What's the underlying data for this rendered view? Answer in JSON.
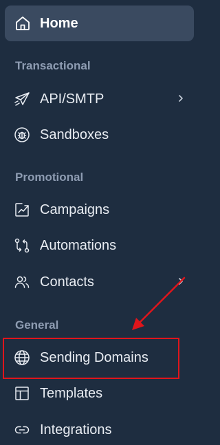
{
  "nav": {
    "home": {
      "label": "Home",
      "icon": "home-icon"
    },
    "sections": [
      {
        "title": "Transactional",
        "items": [
          {
            "label": "API/SMTP",
            "icon": "paper-plane-icon",
            "has_submenu": true
          },
          {
            "label": "Sandboxes",
            "icon": "bug-icon",
            "has_submenu": false
          }
        ]
      },
      {
        "title": "Promotional",
        "items": [
          {
            "label": "Campaigns",
            "icon": "trend-chart-icon",
            "has_submenu": false
          },
          {
            "label": "Automations",
            "icon": "workflow-icon",
            "has_submenu": false
          },
          {
            "label": "Contacts",
            "icon": "users-icon",
            "has_submenu": true
          }
        ]
      },
      {
        "title": "General",
        "items": [
          {
            "label": "Sending Domains",
            "icon": "globe-icon",
            "has_submenu": false
          },
          {
            "label": "Templates",
            "icon": "layout-icon",
            "has_submenu": false
          },
          {
            "label": "Integrations",
            "icon": "link-icon",
            "has_submenu": false
          }
        ]
      }
    ]
  },
  "colors": {
    "background": "#1e2d40",
    "active_item": "#3a4a60",
    "section_title": "#8e9cb2",
    "item_text": "#e8ecf2",
    "annotation": "#e0151b"
  }
}
